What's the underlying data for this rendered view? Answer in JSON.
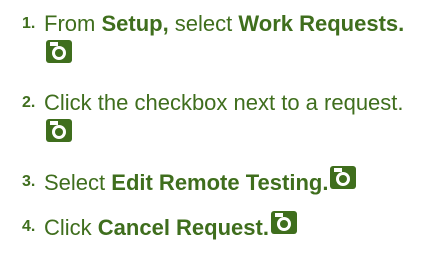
{
  "colors": {
    "text": "#3f6e1d",
    "icon_bg": "#3f6e1d",
    "icon_fg": "#ffffff"
  },
  "icons": {
    "screenshot": "camera-icon"
  },
  "steps": [
    {
      "number": "1.",
      "parts": [
        {
          "text": "From ",
          "bold": false
        },
        {
          "text": "Setup,",
          "bold": true
        },
        {
          "text": " select ",
          "bold": false
        },
        {
          "text": "Work Requests.",
          "bold": true
        }
      ]
    },
    {
      "number": "2.",
      "parts": [
        {
          "text": "Click the checkbox next to a request.",
          "bold": false
        }
      ]
    },
    {
      "number": "3.",
      "parts": [
        {
          "text": "Select ",
          "bold": false
        },
        {
          "text": "Edit Remote Testing.",
          "bold": true
        }
      ]
    },
    {
      "number": "4.",
      "parts": [
        {
          "text": "Click ",
          "bold": false
        },
        {
          "text": "Cancel Request.",
          "bold": true
        }
      ]
    }
  ]
}
